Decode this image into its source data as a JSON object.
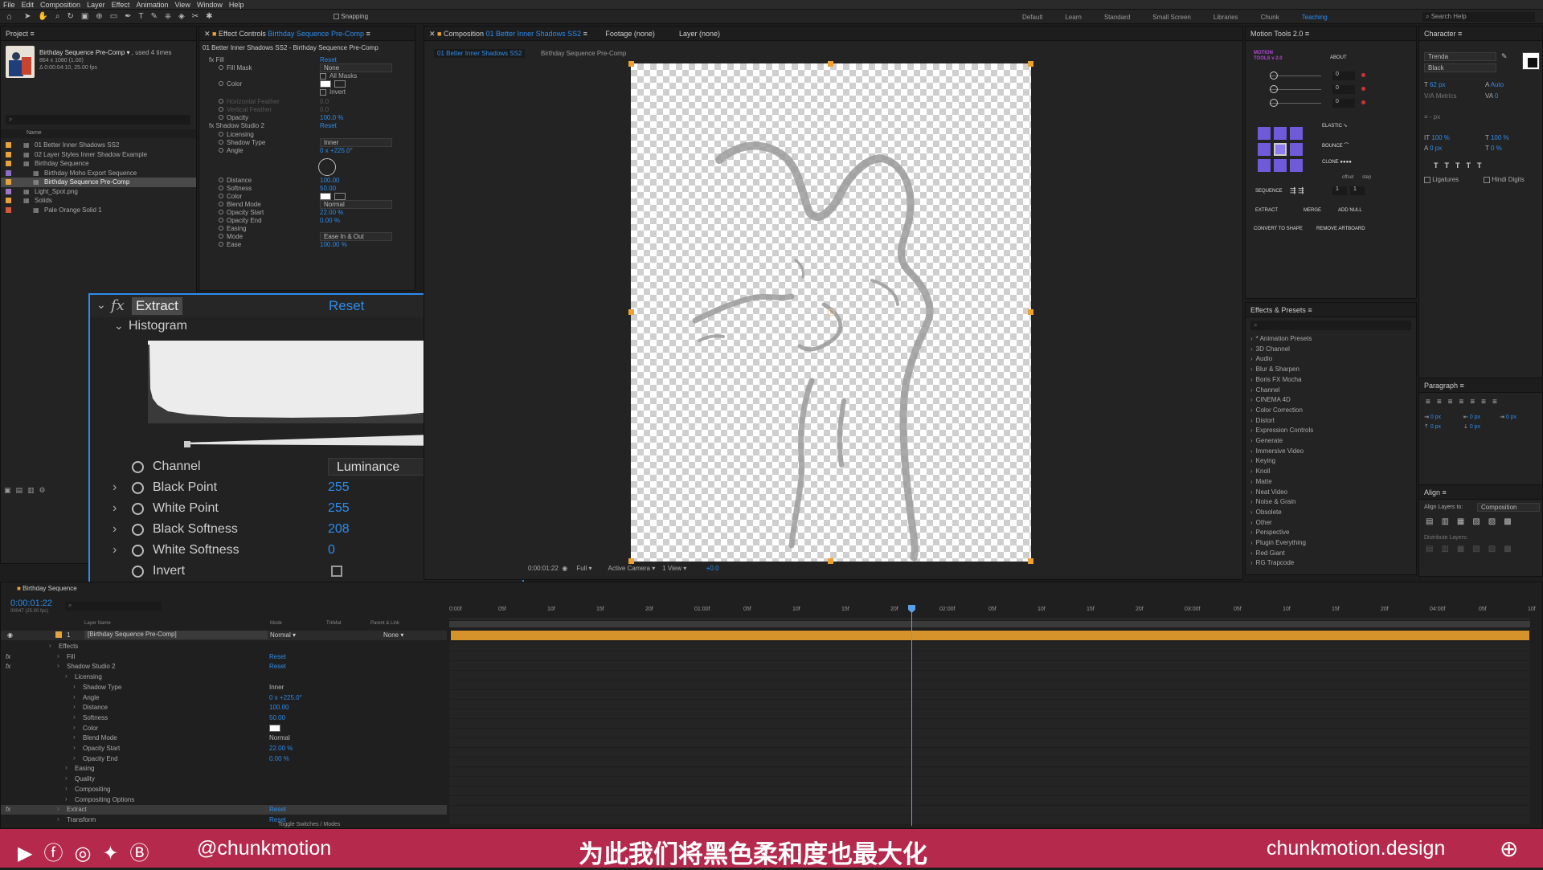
{
  "menu": [
    "File",
    "Edit",
    "Composition",
    "Layer",
    "Effect",
    "Animation",
    "View",
    "Window",
    "Help"
  ],
  "toolbar": {
    "snapping": "Snapping"
  },
  "workspaces": [
    "Default",
    "Learn",
    "Standard",
    "Small Screen",
    "Libraries",
    "Chunk",
    "Teaching"
  ],
  "search_help": "Search Help",
  "project": {
    "title": "Project",
    "item_name": "Birthday Sequence Pre-Comp",
    "used": ", used 4 times",
    "dims": "864 x 1080 (1.00)",
    "duration": "Δ 0:00:04:10, 25.00 fps",
    "col_name": "Name",
    "items": [
      {
        "label": "01 Better Inner Shadows SS2",
        "color": "#e7a23b",
        "indent": 0
      },
      {
        "label": "02 Layer Styles Inner Shadow Example",
        "color": "#e7a23b",
        "indent": 0
      },
      {
        "label": "Birthday Sequence",
        "color": "#e7a23b",
        "indent": 0
      },
      {
        "label": "Birthday Moho Export Sequence",
        "color": "#8a6ec8",
        "indent": 1
      },
      {
        "label": "Birthday Sequence Pre-Comp",
        "color": "#e7a23b",
        "indent": 1
      },
      {
        "label": "Light_Spot.png",
        "color": "#9e77c9",
        "indent": 0
      },
      {
        "label": "Solids",
        "color": "#e7a23b",
        "indent": 0
      },
      {
        "label": "Pale Orange Solid 1",
        "color": "#d4583a",
        "indent": 1
      }
    ]
  },
  "effect_controls": {
    "title": "Effect Controls",
    "layer": "Birthday Sequence Pre-Comp",
    "breadcrumb": "01 Better Inner Shadows SS2 - Birthday Sequence Pre-Comp",
    "rows": [
      {
        "label": "fx  Fill",
        "value": "Reset",
        "vclass": "blue"
      },
      {
        "label": "Fill Mask",
        "value": "None",
        "vclass": "dd"
      },
      {
        "label": "",
        "value": "All Masks",
        "vclass": "chk"
      },
      {
        "label": "Color",
        "value": "",
        "vclass": "color"
      },
      {
        "label": "",
        "value": "Invert",
        "vclass": "chk"
      },
      {
        "label": "Horizontal Feather",
        "value": "0.0",
        "vclass": "dim"
      },
      {
        "label": "Vertical Feather",
        "value": "0.0",
        "vclass": "dim"
      },
      {
        "label": "Opacity",
        "value": "100.0 %",
        "vclass": "blue"
      },
      {
        "label": "fx  Shadow Studio 2",
        "value": "Reset",
        "vclass": "blue"
      },
      {
        "label": "Licensing",
        "value": "",
        "vclass": ""
      },
      {
        "label": "Shadow Type",
        "value": "Inner",
        "vclass": "dd"
      },
      {
        "label": "Angle",
        "value": "0 x +225.0°",
        "vclass": "blue"
      },
      {
        "label": "",
        "value": "",
        "vclass": "dial"
      },
      {
        "label": "Distance",
        "value": "100.00",
        "vclass": "blue"
      },
      {
        "label": "Softness",
        "value": "50.00",
        "vclass": "blue"
      },
      {
        "label": "Color",
        "value": "",
        "vclass": "color"
      },
      {
        "label": "Blend Mode",
        "value": "Normal",
        "vclass": "dd"
      },
      {
        "label": "Opacity Start",
        "value": "22.00 %",
        "vclass": "blue"
      },
      {
        "label": "Opacity End",
        "value": "0.00 %",
        "vclass": "blue"
      },
      {
        "label": "Easing",
        "value": "",
        "vclass": ""
      },
      {
        "label": "Mode",
        "value": "Ease In & Out",
        "vclass": "dd"
      },
      {
        "label": "Ease",
        "value": "100.00 %",
        "vclass": "blue"
      }
    ]
  },
  "extract": {
    "fx": "fx",
    "name": "Extract",
    "reset": "Reset",
    "histogram": "Histogram",
    "props": [
      {
        "label": "Channel",
        "value": "Luminance",
        "type": "dropdown"
      },
      {
        "label": "Black Point",
        "value": "255",
        "type": "number"
      },
      {
        "label": "White Point",
        "value": "255",
        "type": "number"
      },
      {
        "label": "Black Softness",
        "value": "208",
        "type": "number"
      },
      {
        "label": "White Softness",
        "value": "0",
        "type": "number"
      },
      {
        "label": "Invert",
        "value": "",
        "type": "checkbox"
      }
    ]
  },
  "composition": {
    "tab": "Composition",
    "comp": "01 Better Inner Shadows SS2",
    "footage": "Footage (none)",
    "layer": "Layer (none)",
    "crumb1": "01 Better Inner Shadows SS2",
    "crumb2": "Birthday Sequence Pre-Comp",
    "timecode": "0:00:01:22",
    "resolution": "Full",
    "camera": "Active Camera",
    "view": "1 View",
    "exposure": "+0.0"
  },
  "motion_tools": {
    "title": "Motion Tools 2.0",
    "logo": "MOTION TOOLS v 2.0",
    "about": "ABOUT",
    "sliders": [
      "0",
      "0",
      "0"
    ],
    "elastic": "ELASTIC",
    "bounce": "BOUNCE",
    "clone": "CLONE",
    "offset": "offset",
    "step": "step",
    "sequence": "SEQUENCE",
    "seq1": "1",
    "seq2": "1",
    "extract": "EXTRACT",
    "merge": "MERGE",
    "add_null": "ADD NULL",
    "convert": "CONVERT TO SHAPE",
    "remove_artboard": "REMOVE ARTBOARD"
  },
  "effects_presets": {
    "title": "Effects & Presets",
    "items": [
      "* Animation Presets",
      "3D Channel",
      "Audio",
      "Blur & Sharpen",
      "Boris FX Mocha",
      "Channel",
      "CINEMA 4D",
      "Color Correction",
      "Distort",
      "Expression Controls",
      "Generate",
      "Immersive Video",
      "Keying",
      "Knoll",
      "Matte",
      "Neat Video",
      "Noise & Grain",
      "Obsolete",
      "Other",
      "Perspective",
      "Plugin Everything",
      "Red Giant",
      "RG Trapcode"
    ]
  },
  "character": {
    "title": "Character",
    "font": "Trenda",
    "style": "Black",
    "size": "62 px",
    "leading": "Auto",
    "kerning": "Metrics",
    "tracking": "0",
    "stroke": "- px",
    "vscale": "100 %",
    "hscale": "100 %",
    "baseline": "0 px",
    "tsume": "0 %",
    "ligatures": "Ligatures",
    "hindi": "Hindi Digits"
  },
  "paragraph": {
    "title": "Paragraph",
    "indents": [
      "0 px",
      "0 px",
      "0 px",
      "0 px",
      "0 px"
    ]
  },
  "align": {
    "title": "Align",
    "layers_to": "Align Layers to:",
    "target": "Composition",
    "distribute": "Distribute Layers:"
  },
  "timeline": {
    "tab": "Birthday Sequence",
    "timecode": "0:00:01:22",
    "frames": "00047 (25.00 fps)",
    "col_layer": "Layer Name",
    "col_mode": "Mode",
    "col_trkmat": "TrkMat",
    "col_parent": "Parent & Link",
    "layer_num": "1",
    "layer_name": "[Birthday Sequence Pre-Comp]",
    "layer_mode": "Normal",
    "layer_parent": "None",
    "ruler": [
      "0:00f",
      "05f",
      "10f",
      "15f",
      "20f",
      "01:00f",
      "05f",
      "10f",
      "15f",
      "20f",
      "02:00f",
      "05f",
      "10f",
      "15f",
      "20f",
      "03:00f",
      "05f",
      "10f",
      "15f",
      "20f",
      "04:00f",
      "05f",
      "10f"
    ],
    "rows": [
      {
        "label": "Effects",
        "value": ""
      },
      {
        "label": "Fill",
        "value": "Reset"
      },
      {
        "label": "Shadow Studio 2",
        "value": "Reset"
      },
      {
        "label": "Licensing",
        "value": ""
      },
      {
        "label": "Shadow Type",
        "value": "Inner"
      },
      {
        "label": "Angle",
        "value": "0 x +225.0°"
      },
      {
        "label": "Distance",
        "value": "100.00"
      },
      {
        "label": "Softness",
        "value": "50.00"
      },
      {
        "label": "Color",
        "value": ""
      },
      {
        "label": "Blend Mode",
        "value": "Normal"
      },
      {
        "label": "Opacity Start",
        "value": "22.00 %"
      },
      {
        "label": "Opacity End",
        "value": "0.00 %"
      },
      {
        "label": "Easing",
        "value": ""
      },
      {
        "label": "Quality",
        "value": ""
      },
      {
        "label": "Compositing",
        "value": ""
      },
      {
        "label": "Compositing Options",
        "value": ""
      },
      {
        "label": "Extract",
        "value": "Reset"
      },
      {
        "label": "Transform",
        "value": "Reset"
      }
    ],
    "toggle": "Toggle Switches / Modes"
  },
  "footer": {
    "handle": "@chunkmotion",
    "subtitle": "为此我们将黑色柔和度也最大化",
    "site": "chunkmotion.design"
  },
  "colors": {
    "accent": "#2d8ceb",
    "footer": "#b5294d",
    "orange": "#e7a23b",
    "playhead": "#5aa0e6"
  }
}
